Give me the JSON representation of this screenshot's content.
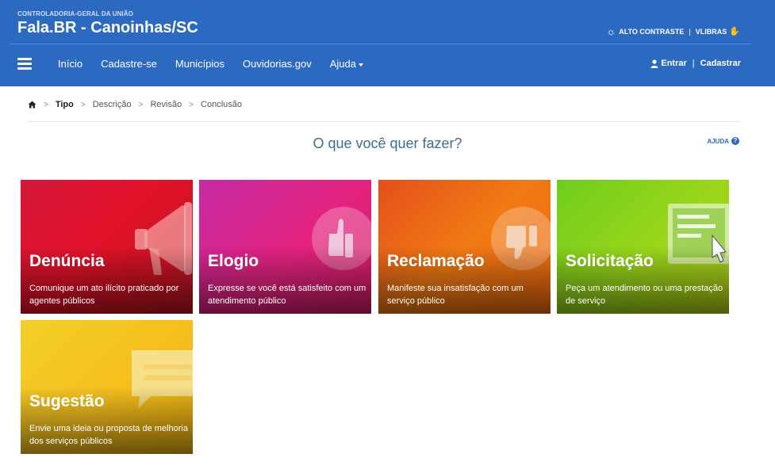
{
  "header": {
    "org": "CONTROLADORIA-GERAL DA UNIÃO",
    "title_main": "Fala.BR",
    "title_sep": " - ",
    "title_city": "Canoinhas/SC",
    "high_contrast": "ALTO CONTRASTE",
    "vlibras": "VLIBRAS"
  },
  "nav": {
    "items": [
      "Início",
      "Cadastre-se",
      "Municípios",
      "Ouvidorias.gov",
      "Ajuda"
    ],
    "login": "Entrar",
    "register": "Cadastrar"
  },
  "breadcrumb": [
    "Tipo",
    "Descrição",
    "Revisão",
    "Conclusão"
  ],
  "main": {
    "question": "O que você quer fazer?",
    "help": "AJUDA"
  },
  "cards": [
    {
      "title": "Denúncia",
      "desc": "Comunique um ato ilícito praticado por agentes públicos",
      "icon": "megaphone-icon"
    },
    {
      "title": "Elogio",
      "desc": "Expresse se você está satisfeito com um atendimento público",
      "icon": "thumbs-up-icon"
    },
    {
      "title": "Reclamação",
      "desc": "Manifeste sua insatisfação com um serviço público",
      "icon": "thumbs-down-icon"
    },
    {
      "title": "Solicitação",
      "desc": "Peça um atendimento ou uma prestação de serviço",
      "icon": "monitor-click-icon"
    },
    {
      "title": "Sugestão",
      "desc": "Envie uma ideia ou proposta de melhoria dos serviços públicos",
      "icon": "speech-bubble-icon"
    }
  ],
  "colors": {
    "header_bg": "#2c69c1",
    "question_text": "#3e6d8c",
    "denuncia": "#e3112a",
    "elogio": "#e4237e",
    "reclamacao": "#f07a13",
    "solicitacao": "#9bd61b",
    "sugestao": "#f6bf1d"
  }
}
